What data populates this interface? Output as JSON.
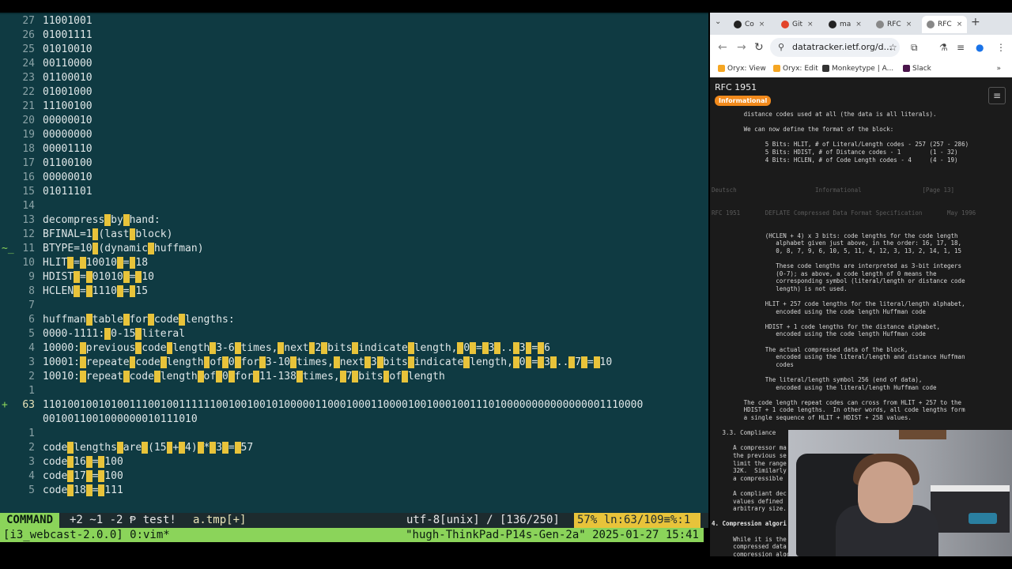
{
  "vim": {
    "lines": [
      {
        "num": "27",
        "text": "11001001"
      },
      {
        "num": "26",
        "text": "01001111"
      },
      {
        "num": "25",
        "text": "01010010"
      },
      {
        "num": "24",
        "text": "00110000"
      },
      {
        "num": "23",
        "text": "01100010"
      },
      {
        "num": "22",
        "text": "01001000"
      },
      {
        "num": "21",
        "text": "11100100"
      },
      {
        "num": "20",
        "text": "00000010"
      },
      {
        "num": "19",
        "text": "00000000"
      },
      {
        "num": "18",
        "text": "00001110"
      },
      {
        "num": "17",
        "text": "01100100"
      },
      {
        "num": "16",
        "text": "00000010"
      },
      {
        "num": "15",
        "text": "01011101"
      },
      {
        "num": "14",
        "text": ""
      },
      {
        "num": "13",
        "text": "decompress by hand:"
      },
      {
        "num": "12",
        "text": "BFINAL=1 (last block)"
      },
      {
        "num": "11",
        "text": "BTYPE=10 (dynamic huffman)",
        "sign": "~_"
      },
      {
        "num": "10",
        "text": "HLIT = 10010 = 18"
      },
      {
        "num": "9",
        "text": "HDIST = 01010 = 10"
      },
      {
        "num": "8",
        "text": "HCLEN = 1110 = 15"
      },
      {
        "num": "7",
        "text": ""
      },
      {
        "num": "6",
        "text": "huffman table for code lengths:"
      },
      {
        "num": "5",
        "text": "0000-1111: 0-15 literal"
      },
      {
        "num": "4",
        "text": "10000: previous code length 3-6 times, next 2 bits indicate length, 0 = 3 .. 3 = 6"
      },
      {
        "num": "3",
        "text": "10001: repeate code length of 0 for 3-10 times, next 3 bits indicate length, 0 = 3 .. 7 = 10"
      },
      {
        "num": "2",
        "text": "10010: repeat code length of 0 for 11-138 times, 7 bits of length"
      },
      {
        "num": "1",
        "text": ""
      },
      {
        "num": "63",
        "text": "1101001001010011100100111111001001001010000011000100011000010010001001110100000000000000001110000",
        "sign": "+",
        "current": true
      },
      {
        "num": "",
        "text": "0010011001000000010111010"
      },
      {
        "num": "1",
        "text": ""
      },
      {
        "num": "2",
        "text": "code lengths are (15 + 4) * 3 = 57"
      },
      {
        "num": "3",
        "text": "code 16 = 100"
      },
      {
        "num": "4",
        "text": "code 17 = 100"
      },
      {
        "num": "5",
        "text": "code 18 = 111"
      }
    ],
    "status": {
      "mode": "COMMAND",
      "git": "+2 ~1 -2 Ᵽ test!",
      "file": "a.tmp[+]",
      "encoding": "utf-8[unix] / [136/250]",
      "position": "57% ln:63/109≡%:1"
    },
    "cmdline": "/"
  },
  "i3bar": {
    "left": "[i3_webcast-2.0.0] 0:vim*",
    "right": "\"hugh-ThinkPad-P14s-Gen-2a\" 2025-01-27 15:41"
  },
  "browser": {
    "tabs": [
      {
        "label": "Co",
        "color": "#222"
      },
      {
        "label": "Git",
        "color": "#e24329"
      },
      {
        "label": "ma",
        "color": "#222"
      },
      {
        "label": "RFC",
        "color": "#888"
      },
      {
        "label": "RFC",
        "color": "#888",
        "active": true
      }
    ],
    "url": "datatracker.ietf.org/d...",
    "bookmarks": [
      {
        "label": "Oryx: View",
        "color": "#f5a623"
      },
      {
        "label": "Oryx: Edit",
        "color": "#f5a623"
      },
      {
        "label": "Monkeytype | A...",
        "color": "#333"
      },
      {
        "label": "Slack",
        "color": "#4a154b"
      }
    ],
    "rfc_title": "RFC 1951",
    "rfc_badge": "Informational",
    "rfc_text": [
      {
        "t": "         distance codes used at all (the data is all literals).",
        "c": ""
      },
      {
        "t": "",
        "c": ""
      },
      {
        "t": "         We can now define the format of the block:",
        "c": ""
      },
      {
        "t": "",
        "c": ""
      },
      {
        "t": "               5 Bits: HLIT, # of Literal/Length codes - 257 (257 - 286)",
        "c": ""
      },
      {
        "t": "               5 Bits: HDIST, # of Distance codes - 1        (1 - 32)",
        "c": ""
      },
      {
        "t": "               4 Bits: HCLEN, # of Code Length codes - 4     (4 - 19)",
        "c": ""
      },
      {
        "t": "",
        "c": ""
      },
      {
        "t": "",
        "c": ""
      },
      {
        "t": "",
        "c": ""
      },
      {
        "t": "Deutsch                      Informational                 [Page 13]",
        "c": "dim"
      },
      {
        "t": "",
        "c": ""
      },
      {
        "t": "",
        "c": ""
      },
      {
        "t": "RFC 1951       DEFLATE Compressed Data Format Specification       May 1996",
        "c": "dim"
      },
      {
        "t": "",
        "c": ""
      },
      {
        "t": "",
        "c": ""
      },
      {
        "t": "               (HCLEN + 4) x 3 bits: code lengths for the code length",
        "c": ""
      },
      {
        "t": "                  alphabet given just above, in the order: 16, 17, 18,",
        "c": ""
      },
      {
        "t": "                  0, 8, 7, 9, 6, 10, 5, 11, 4, 12, 3, 13, 2, 14, 1, 15",
        "c": ""
      },
      {
        "t": "",
        "c": ""
      },
      {
        "t": "                  These code lengths are interpreted as 3-bit integers",
        "c": ""
      },
      {
        "t": "                  (0-7); as above, a code length of 0 means the",
        "c": ""
      },
      {
        "t": "                  corresponding symbol (literal/length or distance code",
        "c": ""
      },
      {
        "t": "                  length) is not used.",
        "c": ""
      },
      {
        "t": "",
        "c": ""
      },
      {
        "t": "               HLIT + 257 code lengths for the literal/length alphabet,",
        "c": ""
      },
      {
        "t": "                  encoded using the code length Huffman code",
        "c": ""
      },
      {
        "t": "",
        "c": ""
      },
      {
        "t": "               HDIST + 1 code lengths for the distance alphabet,",
        "c": ""
      },
      {
        "t": "                  encoded using the code length Huffman code",
        "c": ""
      },
      {
        "t": "",
        "c": ""
      },
      {
        "t": "               The actual compressed data of the block,",
        "c": ""
      },
      {
        "t": "                  encoded using the literal/length and distance Huffman",
        "c": ""
      },
      {
        "t": "                  codes",
        "c": ""
      },
      {
        "t": "",
        "c": ""
      },
      {
        "t": "               The literal/length symbol 256 (end of data),",
        "c": ""
      },
      {
        "t": "                  encoded using the literal/length Huffman code",
        "c": ""
      },
      {
        "t": "",
        "c": ""
      },
      {
        "t": "         The code length repeat codes can cross from HLIT + 257 to the",
        "c": ""
      },
      {
        "t": "         HDIST + 1 code lengths.  In other words, all code lengths form",
        "c": ""
      },
      {
        "t": "         a single sequence of HLIT + HDIST + 258 values.",
        "c": ""
      },
      {
        "t": "",
        "c": ""
      },
      {
        "t": "   3.3. Compliance",
        "c": ""
      },
      {
        "t": "",
        "c": ""
      },
      {
        "t": "      A compressor ma",
        "c": ""
      },
      {
        "t": "      the previous se",
        "c": ""
      },
      {
        "t": "      limit the range",
        "c": ""
      },
      {
        "t": "      32K.  Similarly",
        "c": ""
      },
      {
        "t": "      a compressible",
        "c": ""
      },
      {
        "t": "",
        "c": ""
      },
      {
        "t": "      A compliant dec",
        "c": ""
      },
      {
        "t": "      values defined",
        "c": ""
      },
      {
        "t": "      arbitrary size.",
        "c": ""
      },
      {
        "t": "",
        "c": ""
      },
      {
        "t": "4. Compression algori",
        "c": "bold"
      },
      {
        "t": "",
        "c": ""
      },
      {
        "t": "      While it is the in",
        "c": ""
      },
      {
        "t": "      compressed data fo",
        "c": ""
      },
      {
        "t": "      compression algori",
        "c": ""
      }
    ]
  }
}
